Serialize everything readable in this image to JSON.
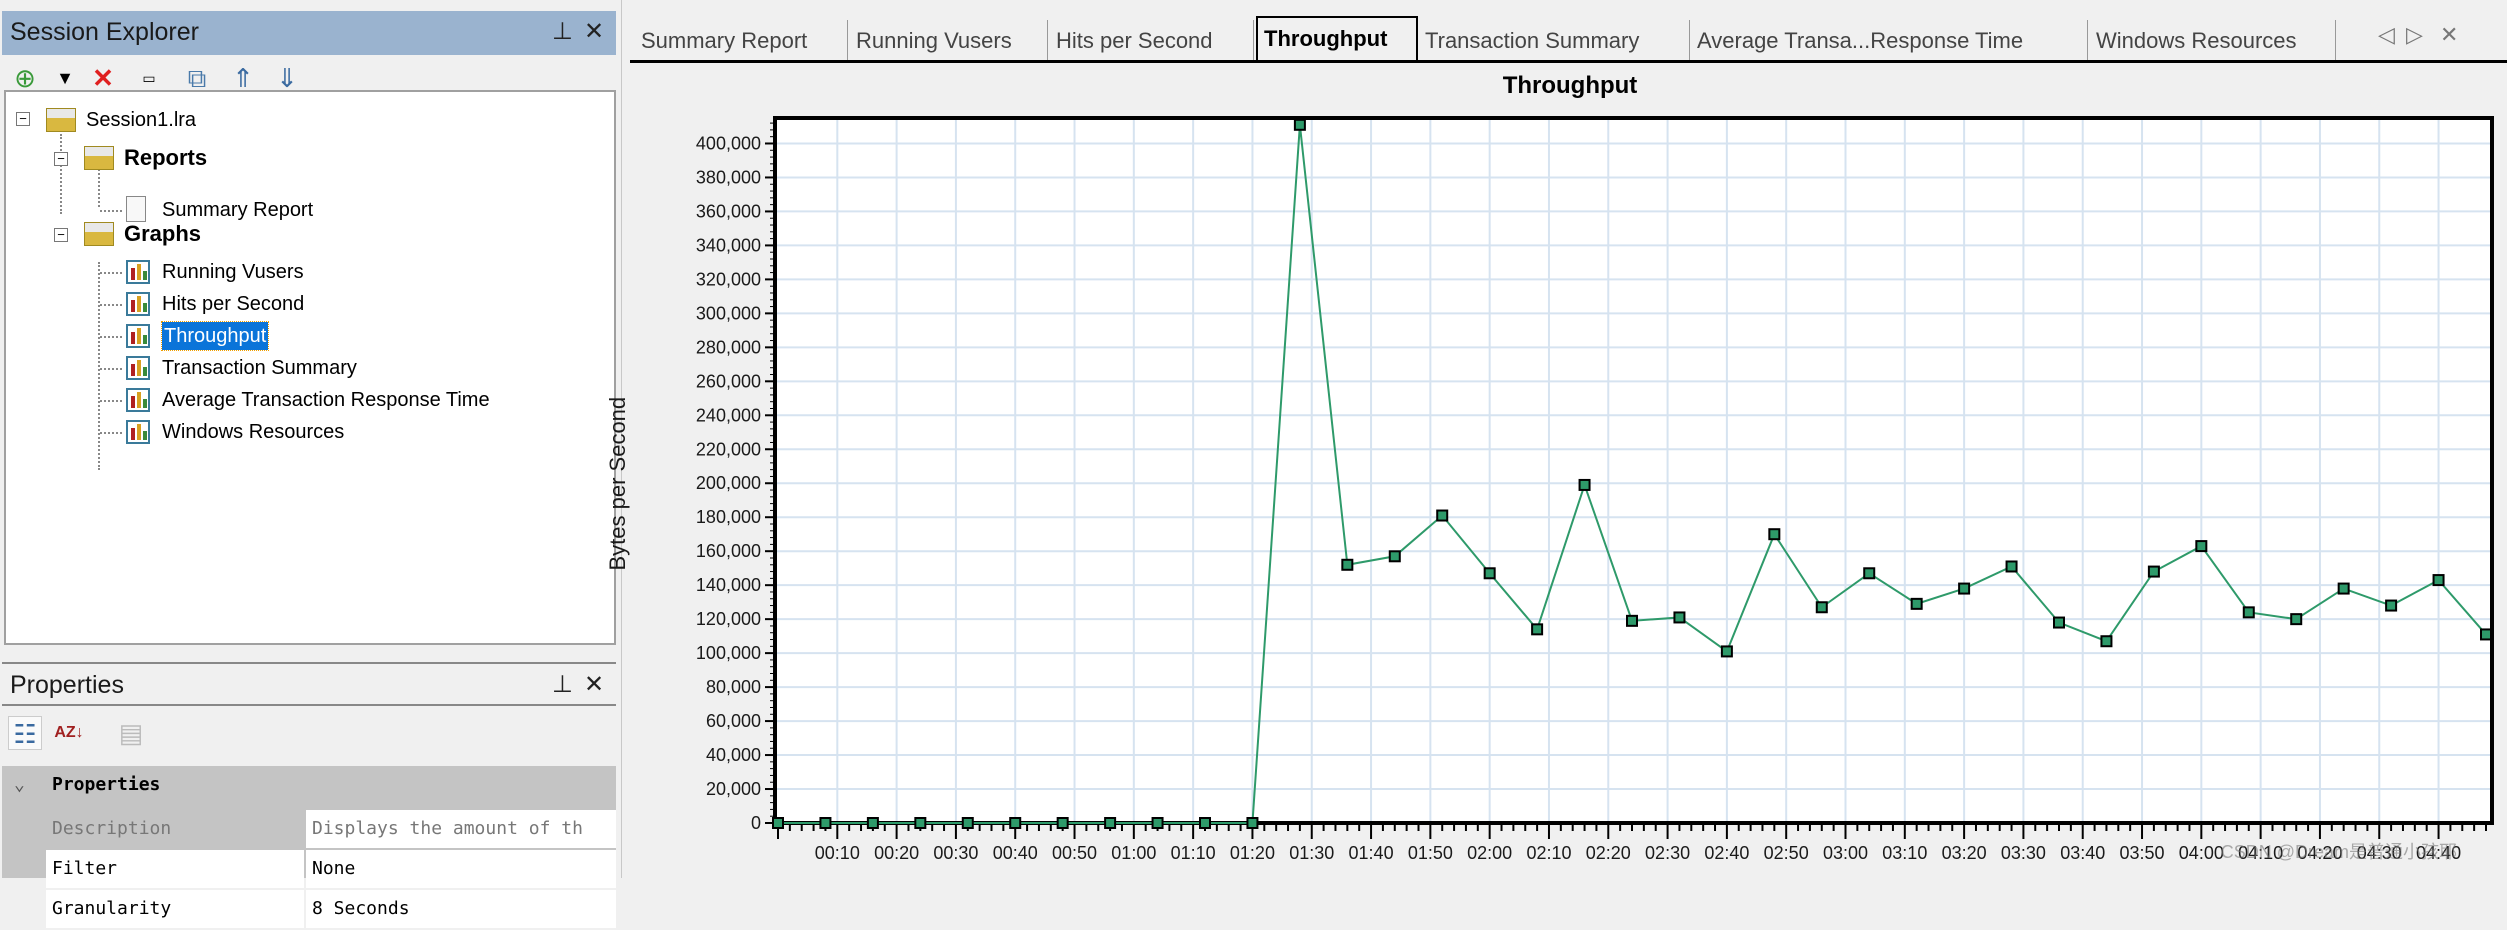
{
  "session_explorer": {
    "title": "Session Explorer",
    "tree": {
      "root": "Session1.lra",
      "reports_folder": "Reports",
      "reports": [
        "Summary Report"
      ],
      "graphs_folder": "Graphs",
      "graphs": [
        "Running Vusers",
        "Hits per Second",
        "Throughput",
        "Transaction Summary",
        "Average Transaction Response Time",
        "Windows Resources"
      ],
      "selected": "Throughput"
    }
  },
  "properties": {
    "title": "Properties",
    "group": "Properties",
    "rows": [
      {
        "label": "Description",
        "value": "Displays the amount of th"
      },
      {
        "label": "Filter",
        "value": "None"
      },
      {
        "label": "Granularity",
        "value": "8 Seconds"
      }
    ]
  },
  "tabs": [
    "Summary Report",
    "Running Vusers",
    "Hits per Second",
    "Throughput",
    "Transaction Summary",
    "Average Transa...Response Time",
    "Windows Resources"
  ],
  "active_tab": "Throughput",
  "watermark": "CSDN @Dream是普通小孩耶",
  "chart_data": {
    "type": "line",
    "title": "Throughput",
    "ylabel": "Bytes per Second",
    "xlim_seconds": [
      0,
      288
    ],
    "ylim": [
      0,
      415000
    ],
    "grid": true,
    "line_color": "#2e9a6a",
    "y_ticks": [
      "0",
      "20,000",
      "40,000",
      "60,000",
      "80,000",
      "100,000",
      "120,000",
      "140,000",
      "160,000",
      "180,000",
      "200,000",
      "220,000",
      "240,000",
      "260,000",
      "280,000",
      "300,000",
      "320,000",
      "340,000",
      "360,000",
      "380,000",
      "400,000"
    ],
    "x_ticks": [
      "00:10",
      "00:20",
      "00:30",
      "00:40",
      "00:50",
      "01:00",
      "01:10",
      "01:20",
      "01:30",
      "01:40",
      "01:50",
      "02:00",
      "02:10",
      "02:20",
      "02:30",
      "02:40",
      "02:50",
      "03:00",
      "03:10",
      "03:20",
      "03:30",
      "03:40",
      "03:50",
      "04:00",
      "04:10",
      "04:20",
      "04:30",
      "04:40"
    ],
    "x": [
      "00:00",
      "00:08",
      "00:16",
      "00:24",
      "00:32",
      "00:40",
      "00:48",
      "00:56",
      "01:04",
      "01:12",
      "01:20",
      "01:28",
      "01:36",
      "01:44",
      "01:52",
      "02:00",
      "02:08",
      "02:16",
      "02:24",
      "02:32",
      "02:40",
      "02:48",
      "02:56",
      "03:04",
      "03:12",
      "03:20",
      "03:28",
      "03:36",
      "03:44",
      "03:52",
      "04:00",
      "04:08",
      "04:16",
      "04:24",
      "04:32",
      "04:40",
      "04:48"
    ],
    "values": [
      0,
      0,
      0,
      0,
      0,
      0,
      0,
      0,
      0,
      0,
      0,
      411000,
      152000,
      157000,
      181000,
      147000,
      114000,
      199000,
      119000,
      121000,
      101000,
      170000,
      127000,
      147000,
      129000,
      138000,
      151000,
      118000,
      107000,
      148000,
      163000,
      124000,
      120000,
      138000,
      128000,
      143000,
      111000
    ]
  }
}
